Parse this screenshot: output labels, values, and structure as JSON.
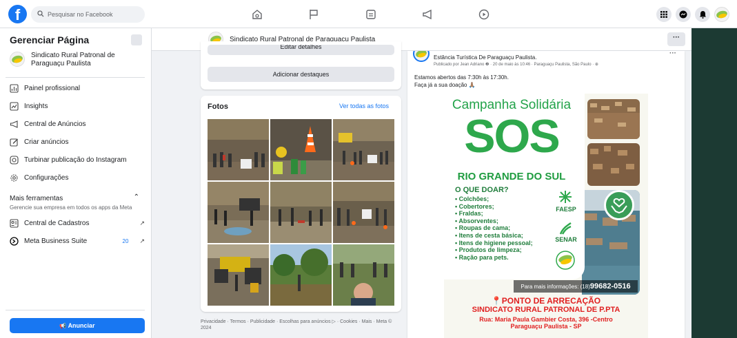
{
  "topbar": {
    "logo": "f",
    "search_placeholder": "Pesquisar no Facebook",
    "nav_icons": [
      "home-icon",
      "flag-icon",
      "marketplace-icon",
      "megaphone-icon",
      "video-icon"
    ],
    "right_icons": [
      "grid-menu-icon",
      "messenger-icon",
      "bell-icon",
      "page-avatar-icon"
    ]
  },
  "sidebar": {
    "title": "Gerenciar Página",
    "page_name": "Sindicato Rural Patronal de Paraguaçu Paulista",
    "items": [
      {
        "label": "Painel profissional",
        "icon": "dashboard-icon"
      },
      {
        "label": "Insights",
        "icon": "insights-icon"
      },
      {
        "label": "Central de Anúncios",
        "icon": "megaphone-icon"
      },
      {
        "label": "Criar anúncios",
        "icon": "pencil-icon"
      },
      {
        "label": "Turbinar publicação do Instagram",
        "icon": "instagram-icon"
      },
      {
        "label": "Configurações",
        "icon": "gear-icon"
      }
    ],
    "more_tools_title": "Mais ferramentas",
    "more_tools_sub": "Gerencie sua empresa em todos os apps da Meta",
    "tools": [
      {
        "label": "Central de Cadastros",
        "icon": "accounts-icon",
        "badge": ""
      },
      {
        "label": "Meta Business Suite",
        "icon": "meta-icon",
        "badge": "20"
      }
    ],
    "anunciar": "Anunciar"
  },
  "pagebar": {
    "title": "Sindicato Rural Patronal de Paraquaçu Paulista",
    "more": "···"
  },
  "left_col": {
    "edit_details": "Editar detalhes",
    "add_highlights": "Adicionar destaques",
    "photos_title": "Fotos",
    "photos_link": "Ver todas as fotos",
    "footer": "Privacidade · Termos · Publicidade · Escolhas para anúncios ▷ · Cookies · Mais · Meta © 2024"
  },
  "post": {
    "name": "Estância Turística De Paraguaçu Paulista.",
    "meta": "Publicado por Jean Adriano ❷ · 20 de maio às 10:46 · Paraguaçu Paulista, São Paulo · ⊕",
    "text_line1": "Estamos abertos das 7:30h às 17:30h.",
    "text_line2": "Faça já a sua doação 🙏🏽",
    "more": "···"
  },
  "flyer": {
    "title": "Campanha Solidária",
    "sos": "SOS",
    "subtitle": "RIO GRANDE DO SUL",
    "question": "O QUE DOAR?",
    "items": [
      "• Colchões;",
      "• Cobertores;",
      "• Fraldas;",
      "• Absorventes;",
      "• Roupas de cama;",
      "• Itens de cesta básica;",
      "• Itens de higiene pessoal;",
      "• Produtos de limpeza;",
      "• Ração para pets."
    ],
    "faesp": "FAESP",
    "senar": "SENAR",
    "contact_prefix": "Para mais informações: (18)",
    "contact_number": "99682-0516",
    "ponto": "PONTO DE ARRECAÇÃO",
    "sindicato": "SINDICATO RURAL PATRONAL DE P.PTA",
    "rua": "Rua: Maria Paula Gambier Costa, 396 -Centro",
    "cidade": "Paraguaçu Paulista - SP"
  },
  "colors": {
    "fb_blue": "#1877f2",
    "green": "#2ea84c",
    "red": "#e02020",
    "bg": "#f0f2f5"
  }
}
